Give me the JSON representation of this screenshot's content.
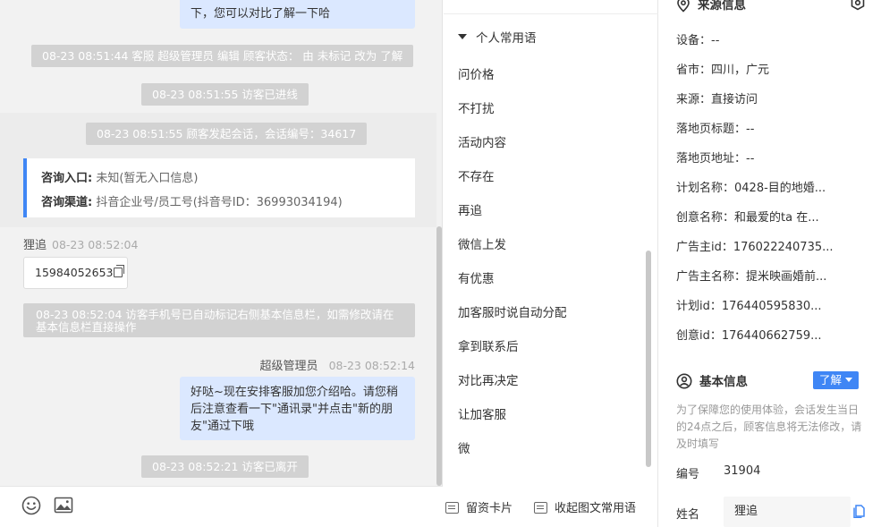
{
  "chat": {
    "messages": {
      "bubble_top": "下，您可以对比了解一下哈",
      "sys_status_change": "08-23 08:51:44 客服 超级管理员 编辑 顾客状态： 由 未标记 改为 了解",
      "sys_entered": "08-23 08:51:55 访客已进线",
      "sys_session": "08-23 08:51:55 顾客发起会话，会话编号：34617",
      "entry_label": "咨询入口:",
      "entry_value": "未知(暂无入口信息)",
      "channel_label": "咨询渠道:",
      "channel_value": "抖音企业号/员工号(抖音号ID：36993034194)",
      "visitor_name": "狸追",
      "visitor_time": "08-23 08:52:04",
      "visitor_phone": "15984052653",
      "sys_phone_note": "08-23 08:52:04 访客手机号已自动标记右侧基本信息栏，如需修改请在基本信息栏直接操作",
      "agent_name": "超级管理员",
      "agent_time": "08-23 08:52:14",
      "agent_message": "好哒~现在安排客服加您介绍哈。请您稍后注意查看一下\"通讯录\"并点击\"新的朋友\"通过下哦",
      "sys_left": "08-23 08:52:21 访客已离开"
    },
    "toolbar": {
      "emoji_icon": "smile-icon",
      "image_icon": "image-icon"
    }
  },
  "phrases": {
    "section_title": "个人常用语",
    "items": [
      "问价格",
      "不打扰",
      "活动内容",
      "不存在",
      "再追",
      "微信上发",
      "有优惠",
      "加客服时说自动分配",
      "拿到联系后",
      "对比再决定",
      "让加客服",
      "微"
    ],
    "card_button": "留资卡片",
    "collapse_button": "收起图文常用语"
  },
  "info": {
    "source_title": "来源信息",
    "source_fields": [
      "设备：--",
      "省市：四川，广元",
      "来源：直接访问",
      "落地页标题：--",
      "落地页地址：--",
      "计划名称：0428-目的地婚...",
      "创意名称：和最爱的ta 在...",
      "广告主id：176022240735...",
      "广告主名称：提米映画婚前...",
      "计划id：176440595830...",
      "创意id：176440662759..."
    ],
    "basic_title": "基本信息",
    "status_badge": "了解",
    "hint": "为了保障您的使用体验，会话发生当日的24点之后，顾客信息将无法修改，请及时填写",
    "id_label": "编号",
    "id_value": "31904",
    "name_label": "姓名",
    "name_value": "狸追"
  },
  "colors": {
    "accent": "#3f86f5",
    "agent_bubble": "#dbe8ff",
    "system_pill": "#d2d2d2"
  }
}
